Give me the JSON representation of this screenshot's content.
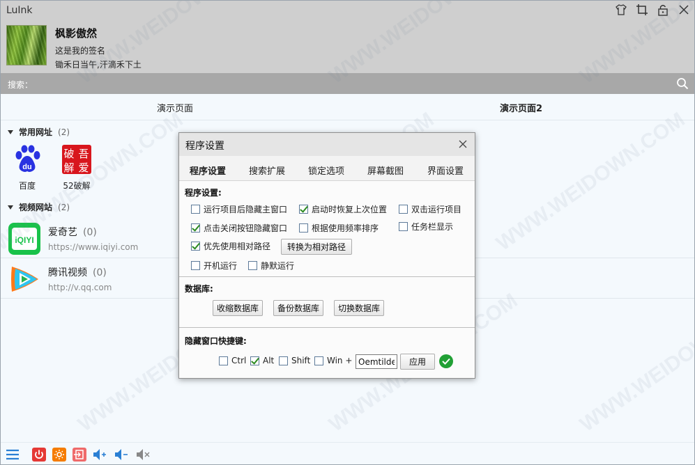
{
  "window": {
    "title": "LuInk"
  },
  "profile": {
    "nickname": "枫影傲然",
    "signature1": "这是我的签名",
    "signature2": "锄禾日当午,汗滴禾下土"
  },
  "search": {
    "label": "搜索：",
    "value": ""
  },
  "tabs": [
    {
      "label": "演示页面"
    },
    {
      "label": "演示页面2"
    }
  ],
  "groups": [
    {
      "name": "常用网址",
      "count": "(2)",
      "items": [
        {
          "label": "百度"
        },
        {
          "label": "52破解"
        }
      ]
    },
    {
      "name": "视频网站",
      "count": "(2)",
      "items": [
        {
          "name": "爱奇艺",
          "count": "(0)",
          "url": "https://www.iqiyi.com"
        },
        {
          "name": "腾讯视频",
          "count": "(0)",
          "url": "http://v.qq.com"
        }
      ]
    }
  ],
  "icons": {
    "logo_52_text": [
      "破",
      "吾",
      "解",
      "爱"
    ],
    "iqiyi_text": "iQIYI",
    "baidu_text": "du"
  },
  "dialog": {
    "title": "程序设置",
    "tabs": [
      "程序设置",
      "搜索扩展",
      "锁定选项",
      "屏幕截图",
      "界面设置"
    ],
    "section_program": "程序设置:",
    "options": [
      {
        "label": "运行项目后隐藏主窗口",
        "checked": false
      },
      {
        "label": "启动时恢复上次位置",
        "checked": true
      },
      {
        "label": "双击运行项目",
        "checked": false
      },
      {
        "label": "点击关闭按钮隐藏窗口",
        "checked": true
      },
      {
        "label": "根据使用频率排序",
        "checked": false
      },
      {
        "label": "任务栏显示",
        "checked": false
      },
      {
        "label": "优先使用相对路径",
        "checked": true
      },
      {
        "label": "开机运行",
        "checked": false
      },
      {
        "label": "静默运行",
        "checked": false
      }
    ],
    "btn_relative": "转换为相对路径",
    "section_db": "数据库:",
    "db_buttons": [
      "收缩数据库",
      "备份数据库",
      "切换数据库"
    ],
    "section_hotkey": "隐藏窗口快捷键:",
    "hotkey": {
      "ctrl": {
        "label": "Ctrl",
        "checked": false
      },
      "alt": {
        "label": "Alt",
        "checked": true
      },
      "shift": {
        "label": "Shift",
        "checked": false
      },
      "win": {
        "label": "Win +",
        "checked": false
      },
      "key": "Oemtilde",
      "apply": "应用"
    }
  },
  "watermark": "WWW.WEIDOWN.COM",
  "colors": {
    "accent": "#2a8de0",
    "power": "#e53935",
    "orange": "#f57c00",
    "ok": "#21a035"
  }
}
